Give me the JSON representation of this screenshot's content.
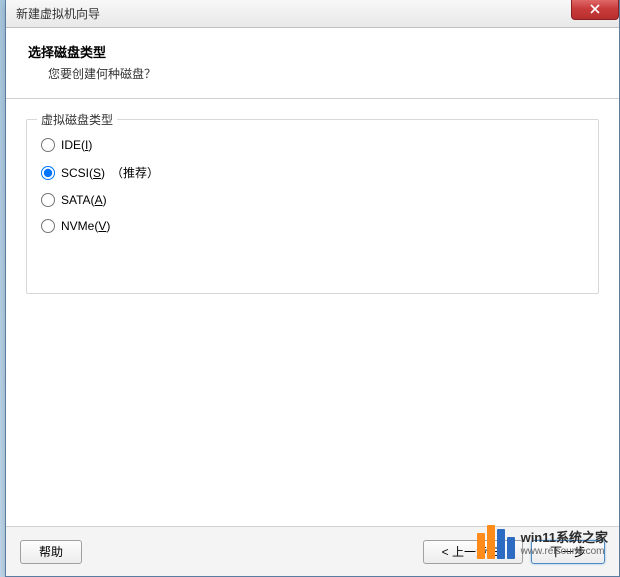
{
  "window": {
    "title": "新建虚拟机向导"
  },
  "header": {
    "title": "选择磁盘类型",
    "subtitle": "您要创建何种磁盘？"
  },
  "group": {
    "legend": "虚拟磁盘类型",
    "options": {
      "ide": {
        "prefix": "IDE(",
        "accel": "I",
        "suffix": ")"
      },
      "scsi": {
        "prefix": "SCSI(",
        "accel": "S",
        "suffix": ")",
        "note": "（推荐）"
      },
      "sata": {
        "prefix": "SATA(",
        "accel": "A",
        "suffix": ")"
      },
      "nvme": {
        "prefix": "NVMe(",
        "accel": "V",
        "suffix": ")"
      }
    },
    "selected": "scsi"
  },
  "footer": {
    "help": "帮助",
    "back": "< 上一步(B)",
    "next": "下一步"
  },
  "watermark": {
    "title": "win11系统之家",
    "url": "www.relsound.com"
  }
}
